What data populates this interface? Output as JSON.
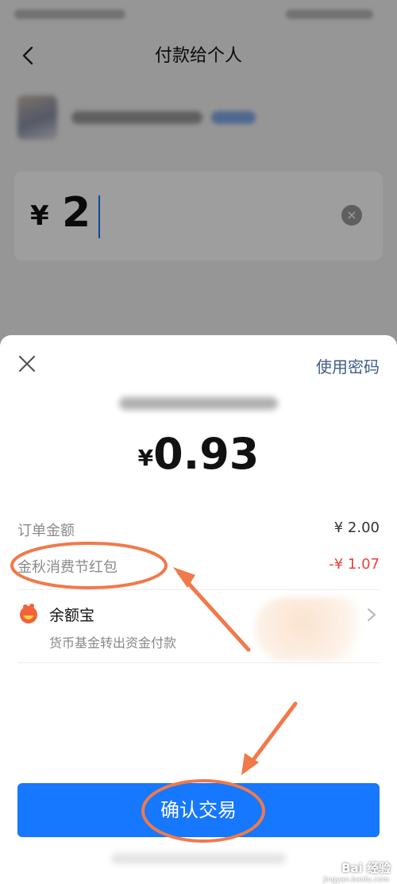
{
  "header": {
    "title": "付款给个人",
    "back_icon": "chevron-left-icon"
  },
  "amount_card": {
    "currency_symbol": "¥",
    "value": "2",
    "clear_icon": "clear-icon"
  },
  "sheet": {
    "close_icon": "close-icon",
    "use_password_label": "使用密码",
    "amount_currency": "¥",
    "amount_value": "0.93",
    "order_amount_label": "订单金额",
    "order_amount_value": "¥ 2.00",
    "discount_label": "金秋消费节红包",
    "discount_value": "-¥ 1.07",
    "payment_method": {
      "name": "余额宝",
      "description": "货币基金转出资金付款",
      "icon": "yuebao-icon",
      "chevron_icon": "chevron-right-icon"
    },
    "confirm_label": "确认交易"
  },
  "watermark": {
    "text": "Bai 经验",
    "url": "jingyan.baidu.com"
  },
  "colors": {
    "primary": "#1677ff",
    "discount_red": "#e8423a",
    "link": "#3e5f8a",
    "annotation": "#f07a4a"
  }
}
